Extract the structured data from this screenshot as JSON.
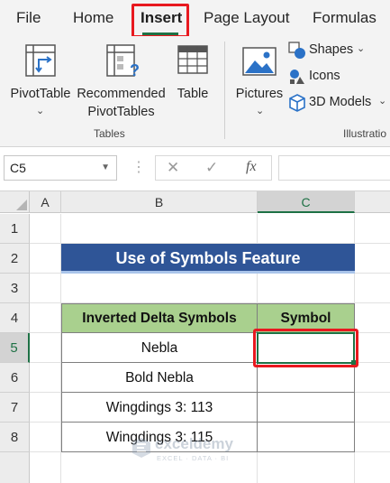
{
  "ribbon_tabs": {
    "file": "File",
    "home": "Home",
    "insert": "Insert",
    "page_layout": "Page Layout",
    "formulas": "Formulas"
  },
  "ribbon": {
    "pivot_table": "PivotTable",
    "recommended_line1": "Recommended",
    "recommended_line2": "PivotTables",
    "table": "Table",
    "tables_group": "Tables",
    "pictures": "Pictures",
    "shapes": "Shapes",
    "icons": "Icons",
    "models_3d": "3D Models",
    "illustrations_group": "Illustratio"
  },
  "formula_bar": {
    "name_box": "C5",
    "fx": "fx",
    "formula": ""
  },
  "columns": [
    "A",
    "B",
    "C"
  ],
  "rows": [
    "1",
    "2",
    "3",
    "4",
    "5",
    "6",
    "7",
    "8"
  ],
  "sheet": {
    "title": "Use of Symbols Feature",
    "headers": {
      "name": "Inverted Delta Symbols",
      "symbol": "Symbol"
    },
    "items": [
      {
        "name": "Nebla",
        "symbol": ""
      },
      {
        "name": "Bold Nebla",
        "symbol": ""
      },
      {
        "name": "Wingdings 3: 113",
        "symbol": ""
      },
      {
        "name": "Wingdings 3: 115",
        "symbol": ""
      }
    ]
  },
  "watermark": "exceldemy",
  "watermark_sub": "EXCEL · DATA · BI",
  "colors": {
    "title_bg": "#2f5597",
    "header_bg": "#a9d08e",
    "highlight": "#e8191f",
    "excel_green": "#1e7145"
  }
}
